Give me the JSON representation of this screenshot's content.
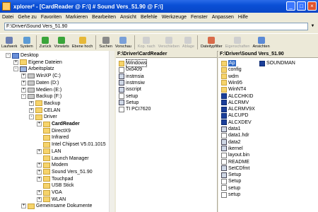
{
  "window": {
    "title": "xplorer² - [CardReader @ F:\\] # Sound Vers_51.90 @ F:\\]"
  },
  "menu": [
    "Datei",
    "Gehe zu",
    "Favoriten",
    "Markieren",
    "Bearbeiten",
    "Ansicht",
    "Befehle",
    "Werkzeuge",
    "Fenster",
    "Anpassen",
    "Hilfe"
  ],
  "address": {
    "value": "F:\\Driver\\Sound Vers_51.90"
  },
  "toolbar": [
    {
      "label": "Laufwerk",
      "icon": "drive-icon",
      "color": "#6b7fb3",
      "enabled": true
    },
    {
      "label": "System",
      "icon": "system-icon",
      "color": "#5c9bd5",
      "enabled": true
    },
    {
      "label": "Zurück",
      "icon": "back-icon",
      "color": "#3aa53a",
      "enabled": true
    },
    {
      "label": "Vorwärts",
      "icon": "forward-icon",
      "color": "#3aa53a",
      "enabled": true
    },
    {
      "label": "Ebene hoch",
      "icon": "up-folder-icon",
      "color": "#e6b838",
      "enabled": true
    },
    {
      "label": "Suchen",
      "icon": "search-icon",
      "color": "#8a8a8a",
      "enabled": true
    },
    {
      "label": "Vorschau",
      "icon": "preview-icon",
      "color": "#7aa0d8",
      "enabled": true
    },
    {
      "label": "Kop. nach",
      "icon": "copy-to-icon",
      "color": "#cfcfcf",
      "enabled": false
    },
    {
      "label": "Verschieben",
      "icon": "move-icon",
      "color": "#cfcfcf",
      "enabled": false
    },
    {
      "label": "Ablage",
      "icon": "stash-icon",
      "color": "#cfcfcf",
      "enabled": false
    },
    {
      "label": "Dateitypfilter",
      "icon": "filter-icon",
      "color": "#d96b4a",
      "enabled": true
    },
    {
      "label": "Eigenschaften",
      "icon": "properties-icon",
      "color": "#cfcfcf",
      "enabled": false
    },
    {
      "label": "Ansichten",
      "icon": "views-icon",
      "color": "#5b8ad6",
      "enabled": true
    }
  ],
  "tree": [
    {
      "label": "Desktop",
      "icon": "desktop",
      "depth": 0,
      "exp": "-"
    },
    {
      "label": "Eigene Dateien",
      "icon": "folder",
      "depth": 1,
      "exp": "+"
    },
    {
      "label": "Arbeitsplatz",
      "icon": "pc",
      "depth": 1,
      "exp": "-"
    },
    {
      "label": "WinXP (C:)",
      "icon": "drive",
      "depth": 2,
      "exp": "+"
    },
    {
      "label": "Daten (D:)",
      "icon": "drive",
      "depth": 2,
      "exp": "+"
    },
    {
      "label": "Medien (E:)",
      "icon": "drive",
      "depth": 2,
      "exp": "+"
    },
    {
      "label": "Backup (F:)",
      "icon": "drive",
      "depth": 2,
      "exp": "-"
    },
    {
      "label": "Backup",
      "icon": "folder",
      "depth": 3,
      "exp": "+"
    },
    {
      "label": "CELAN",
      "icon": "folder",
      "depth": 3,
      "exp": "+"
    },
    {
      "label": "Driver",
      "icon": "folder",
      "depth": 3,
      "exp": "-"
    },
    {
      "label": "CardReader",
      "icon": "folder",
      "depth": 4,
      "exp": "+",
      "bold": true
    },
    {
      "label": "DirectX9",
      "icon": "folder",
      "depth": 4,
      "exp": ""
    },
    {
      "label": "Infrared",
      "icon": "folder",
      "depth": 4,
      "exp": ""
    },
    {
      "label": "Intel Chipset V5.01.1015",
      "icon": "folder",
      "depth": 4,
      "exp": ""
    },
    {
      "label": "LAN",
      "icon": "folder",
      "depth": 4,
      "exp": "+"
    },
    {
      "label": "Launch Manager",
      "icon": "folder",
      "depth": 4,
      "exp": ""
    },
    {
      "label": "Modem",
      "icon": "folder",
      "depth": 4,
      "exp": "+"
    },
    {
      "label": "Sound Vers_51.90",
      "icon": "folder",
      "depth": 4,
      "exp": "+"
    },
    {
      "label": "Touchpad",
      "icon": "folder",
      "depth": 4,
      "exp": "+"
    },
    {
      "label": "USB Stick",
      "icon": "folder",
      "depth": 4,
      "exp": ""
    },
    {
      "label": "VGA",
      "icon": "folder",
      "depth": 4,
      "exp": "+"
    },
    {
      "label": "WLAN",
      "icon": "folder",
      "depth": 4,
      "exp": "+"
    },
    {
      "label": "Gemeinsame Dokumente",
      "icon": "folder",
      "depth": 2,
      "exp": "+"
    }
  ],
  "pane_left": {
    "header": "F:\\Driver\\CardReader",
    "items": [
      {
        "label": "Windows",
        "type": "folder",
        "boxed": true
      },
      {
        "label": "0x0409",
        "type": "file"
      },
      {
        "label": "instmsia",
        "type": "exe"
      },
      {
        "label": "instmsiw",
        "type": "exe"
      },
      {
        "label": "isscript",
        "type": "exe"
      },
      {
        "label": "setup",
        "type": "file"
      },
      {
        "label": "Setup",
        "type": "exe"
      },
      {
        "label": "TI PCI7620",
        "type": "file"
      }
    ]
  },
  "pane_right": {
    "header": "F:\\Driver\\Sound Vers_51.90",
    "items": [
      {
        "label": "Ap",
        "type": "folder",
        "sel": true
      },
      {
        "label": "config",
        "type": "folder"
      },
      {
        "label": "wdm",
        "type": "folder"
      },
      {
        "label": "Win95",
        "type": "folder"
      },
      {
        "label": "WinNT4",
        "type": "folder"
      },
      {
        "label": "ALCCHKID",
        "type": "x"
      },
      {
        "label": "ALCRMV",
        "type": "x"
      },
      {
        "label": "ALCRMV9X",
        "type": "x"
      },
      {
        "label": "ALCUPD",
        "type": "x"
      },
      {
        "label": "ALCXDEV",
        "type": "x"
      },
      {
        "label": "data1",
        "type": "exe"
      },
      {
        "label": "data1.hdr",
        "type": "file"
      },
      {
        "label": "data2",
        "type": "exe"
      },
      {
        "label": "ikernel",
        "type": "exe"
      },
      {
        "label": "layout.bin",
        "type": "file"
      },
      {
        "label": "README",
        "type": "file"
      },
      {
        "label": "SetCDfmt",
        "type": "exe"
      },
      {
        "label": "Setup",
        "type": "exe"
      },
      {
        "label": "Setup",
        "type": "file"
      },
      {
        "label": "setup",
        "type": "file"
      },
      {
        "label": "setup",
        "type": "file"
      }
    ],
    "extra": [
      {
        "label": "SOUNDMAN",
        "type": "x"
      }
    ]
  }
}
